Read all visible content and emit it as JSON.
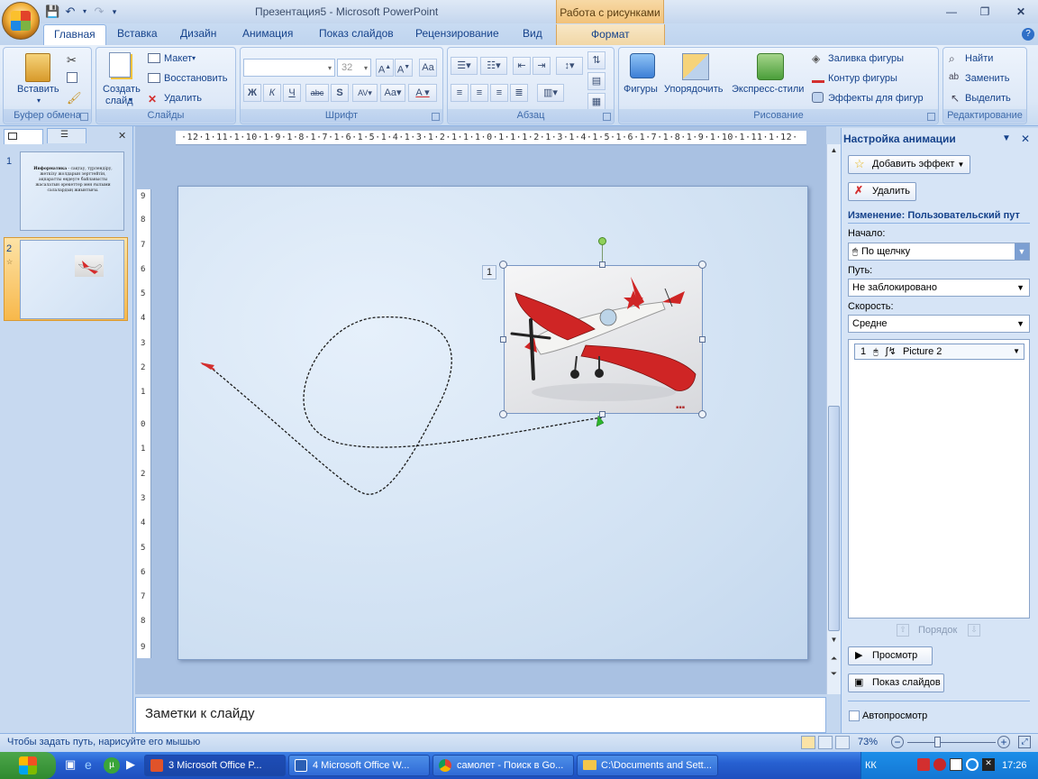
{
  "titlebar": {
    "title": "Презентация5 - Microsoft PowerPoint",
    "context_group": "Работа с рисунками"
  },
  "tabs": [
    {
      "label": "Главная",
      "active": true
    },
    {
      "label": "Вставка"
    },
    {
      "label": "Дизайн"
    },
    {
      "label": "Анимация"
    },
    {
      "label": "Показ слайдов"
    },
    {
      "label": "Рецензирование"
    },
    {
      "label": "Вид"
    },
    {
      "label": "Формат",
      "contextual": true
    }
  ],
  "ribbon": {
    "clipboard": {
      "label": "Буфер обмена",
      "paste": "Вставить"
    },
    "slides": {
      "label": "Слайды",
      "new_slide_1": "Создать",
      "new_slide_2": "слайд",
      "layout": "Макет",
      "reset": "Восстановить",
      "delete": "Удалить"
    },
    "font": {
      "label": "Шрифт",
      "font_name": "",
      "font_size": "32"
    },
    "paragraph": {
      "label": "Абзац"
    },
    "drawing": {
      "label": "Рисование",
      "shapes": "Фигуры",
      "arrange": "Упорядочить",
      "quick_styles": "Экспресс-стили",
      "shape_fill": "Заливка фигуры",
      "shape_outline": "Контур фигуры",
      "shape_effects": "Эффекты для фигур"
    },
    "editing": {
      "label": "Редактирование",
      "find": "Найти",
      "replace": "Заменить",
      "select": "Выделить"
    }
  },
  "slides_pane": {
    "slides": [
      {
        "number": "1",
        "text_bold": "Информатика",
        "text": " - сақтау, түрлендіру, жеткізу жолдарын зерттейтін, ақпаратты өңдеуге байланысты жасалатын әрекеттер мен ғылыми салалардың жиынтығы.",
        "selected": false
      },
      {
        "number": "2",
        "selected": true
      }
    ]
  },
  "ruler": {
    "horizontal": "·12·1·11·1·10·1·9·1·8·1·7·1·6·1·5·1·4·1·3·1·2·1·1·1·0·1·1·1·2·1·3·1·4·1·5·1·6·1·7·1·8·1·9·1·10·1·11·1·12·"
  },
  "slide": {
    "animation_tag": "1",
    "picture_alt": "Picture 2"
  },
  "notes": {
    "placeholder": "Заметки к слайду"
  },
  "task_pane": {
    "title": "Настройка анимации",
    "add_effect": "Добавить эффект",
    "remove": "Удалить",
    "change_title": "Изменение: Пользовательский пут",
    "start_label": "Начало:",
    "start_value": "По щелчку",
    "path_label": "Путь:",
    "path_value": "Не заблокировано",
    "speed_label": "Скорость:",
    "speed_value": "Средне",
    "list": [
      {
        "index": "1",
        "name": "Picture 2"
      }
    ],
    "reorder": "Порядок",
    "play": "Просмотр",
    "slideshow": "Показ слайдов",
    "autopreview": "Автопросмотр"
  },
  "status": {
    "hint": "Чтобы задать путь, нарисуйте его мышью",
    "zoom": "73%"
  },
  "taskbar": {
    "items": [
      {
        "label": "3 Microsoft Office P...",
        "active": true
      },
      {
        "label": "4 Microsoft Office W..."
      },
      {
        "label": "самолет - Поиск в Go..."
      },
      {
        "label": "C:\\Documents and Sett..."
      }
    ],
    "lang": "КК",
    "time": "17:26"
  },
  "colors": {
    "ribbon_bg": "#dbe7f7",
    "accent": "#15428b",
    "context_tab": "#f1c27a",
    "slide_bg": "#cfe0f2",
    "taskbar": "#2760d1"
  }
}
